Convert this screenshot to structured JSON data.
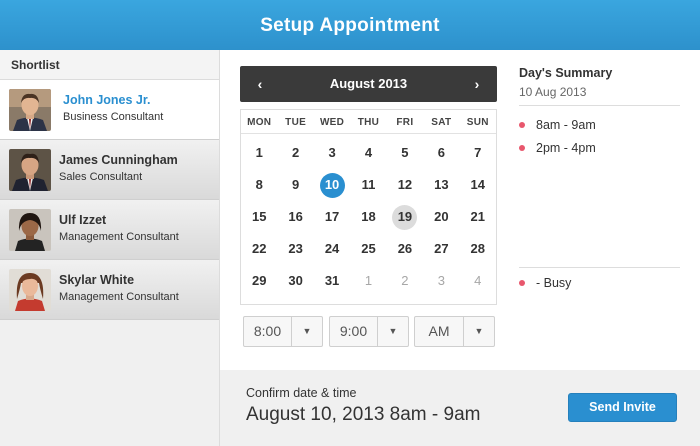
{
  "header": {
    "title": "Setup Appointment"
  },
  "shortlist": {
    "title": "Shortlist",
    "people": [
      {
        "name": "John Jones Jr.",
        "role": "Business Consultant"
      },
      {
        "name": "James Cunningham",
        "role": "Sales Consultant"
      },
      {
        "name": "Ulf Izzet",
        "role": "Management Consultant"
      },
      {
        "name": "Skylar White",
        "role": "Management Consultant"
      }
    ]
  },
  "calendar": {
    "month_label": "August 2013",
    "prev_icon": "‹",
    "next_icon": "›",
    "weekdays": [
      "MON",
      "TUE",
      "WED",
      "THU",
      "FRI",
      "SAT",
      "SUN"
    ],
    "days": [
      "1",
      "2",
      "3",
      "4",
      "5",
      "6",
      "7",
      "8",
      "9",
      "10",
      "11",
      "12",
      "13",
      "14",
      "15",
      "16",
      "17",
      "18",
      "19",
      "20",
      "21",
      "22",
      "23",
      "24",
      "25",
      "26",
      "27",
      "28",
      "29",
      "30",
      "31",
      "1",
      "2",
      "3",
      "4"
    ],
    "selected_day": "10",
    "today_day": "19"
  },
  "time": {
    "hour": "8:00",
    "minute": "9:00",
    "period": "AM"
  },
  "summary": {
    "title": "Day's Summary",
    "date": "10 Aug 2013",
    "slots": [
      "8am - 9am",
      "2pm - 4pm"
    ],
    "legend": "- Busy",
    "busy_color": "#e8576d"
  },
  "footer": {
    "confirm_label": "Confirm date & time",
    "confirm_value": "August 10, 2013 8am - 9am",
    "send_label": "Send Invite"
  }
}
